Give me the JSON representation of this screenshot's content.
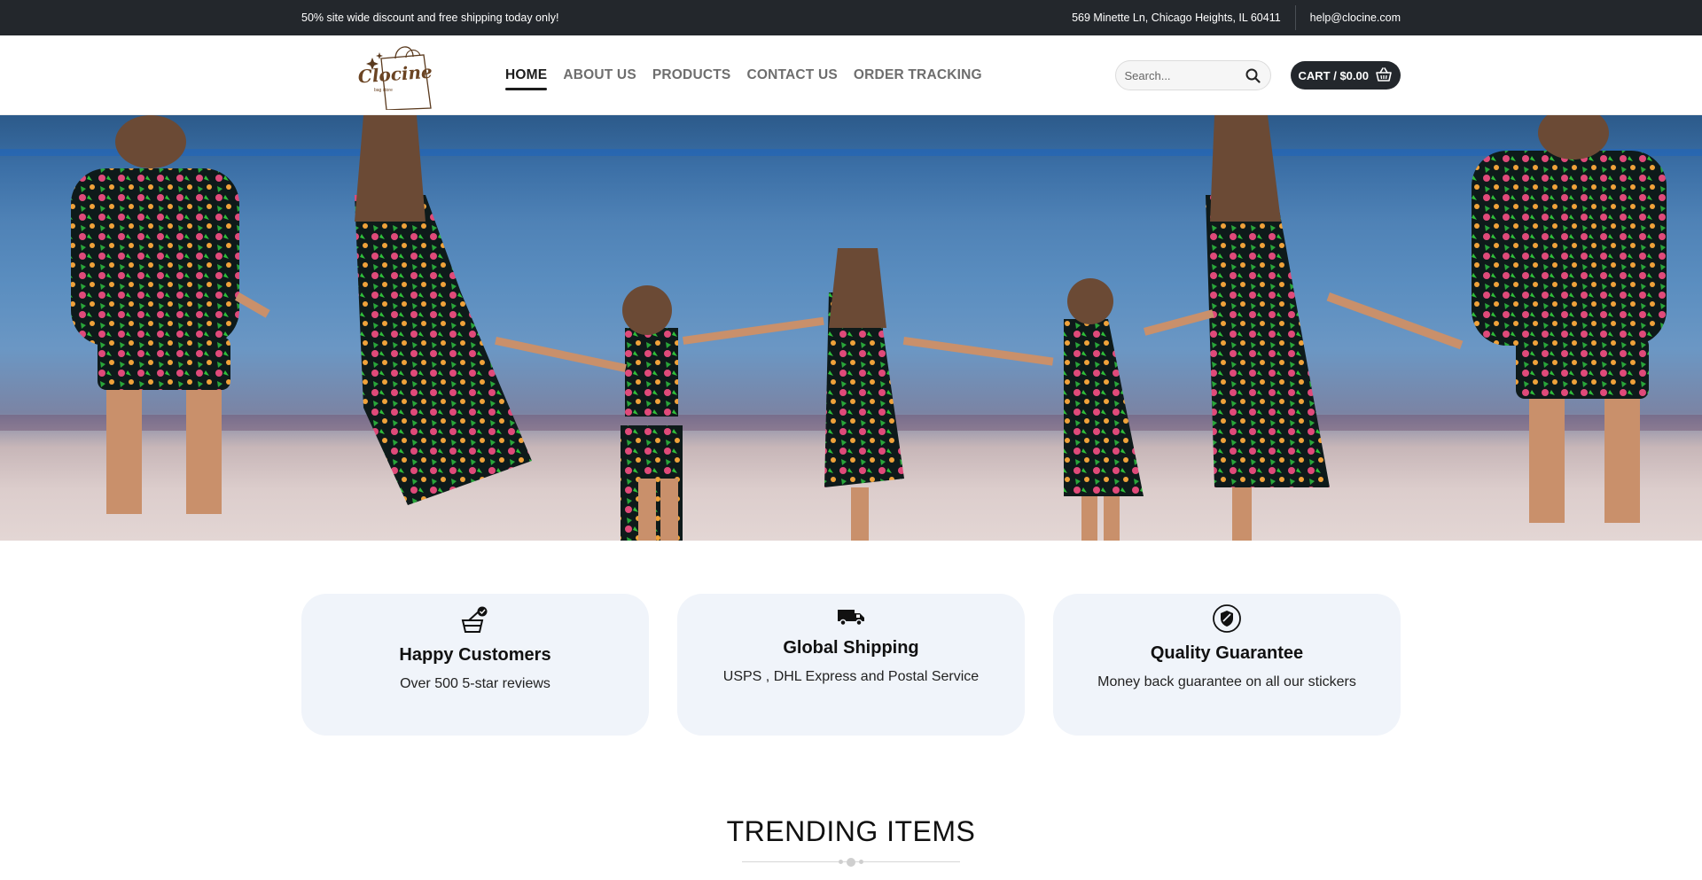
{
  "topbar": {
    "promo": "50% site wide discount and free shipping today only!",
    "address": "569 Minette Ln, Chicago Heights, IL 60411",
    "email": "help@clocine.com"
  },
  "header": {
    "logo_text": "Clocine",
    "logo_sub": "bag store",
    "nav": [
      {
        "label": "HOME"
      },
      {
        "label": "ABOUT US"
      },
      {
        "label": "PRODUCTS"
      },
      {
        "label": "CONTACT US"
      },
      {
        "label": "ORDER TRACKING"
      }
    ],
    "search_placeholder": "Search...",
    "cart_label": "CART / $0.00"
  },
  "features": [
    {
      "title": "Happy Customers",
      "desc": "Over 500 5-star reviews",
      "icon": "basket-icon"
    },
    {
      "title": "Global Shipping",
      "desc": "USPS , DHL Express and Postal Service",
      "icon": "truck-icon"
    },
    {
      "title": "Quality Guarantee",
      "desc": "Money back guarantee on all our stickers",
      "icon": "shield-icon"
    }
  ],
  "trending": {
    "title": "TRENDING ITEMS"
  },
  "colors": {
    "dark": "#23272c",
    "card_bg": "#f0f4fa",
    "nav_inactive": "#6e6e6e"
  }
}
